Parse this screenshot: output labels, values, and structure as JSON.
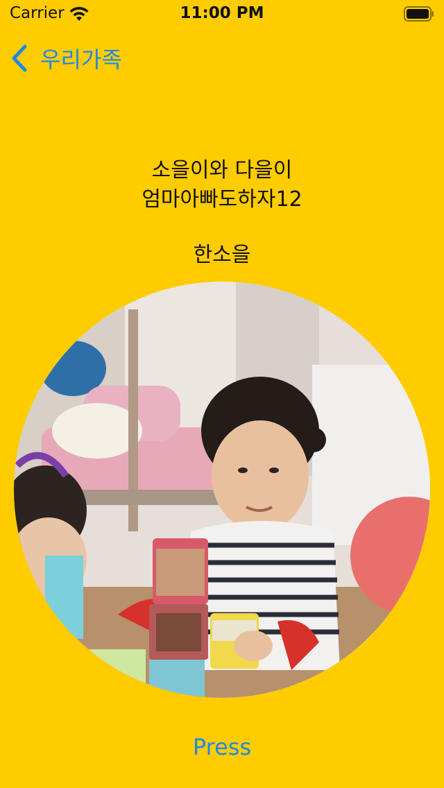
{
  "status_bar": {
    "carrier": "Carrier",
    "time": "11:00 PM",
    "icons": [
      "wifi-icon",
      "battery-icon"
    ]
  },
  "nav": {
    "back_label": "우리가족",
    "back_icon": "chevron-left-icon"
  },
  "content": {
    "line1": "소을이와 다을이",
    "line2": "엄마아빠도하자12",
    "name": "한소을",
    "photo": "family-photo"
  },
  "actions": {
    "press_label": "Press"
  },
  "colors": {
    "background": "#FFCC00",
    "accent": "#1E88E5",
    "text": "#111111"
  }
}
